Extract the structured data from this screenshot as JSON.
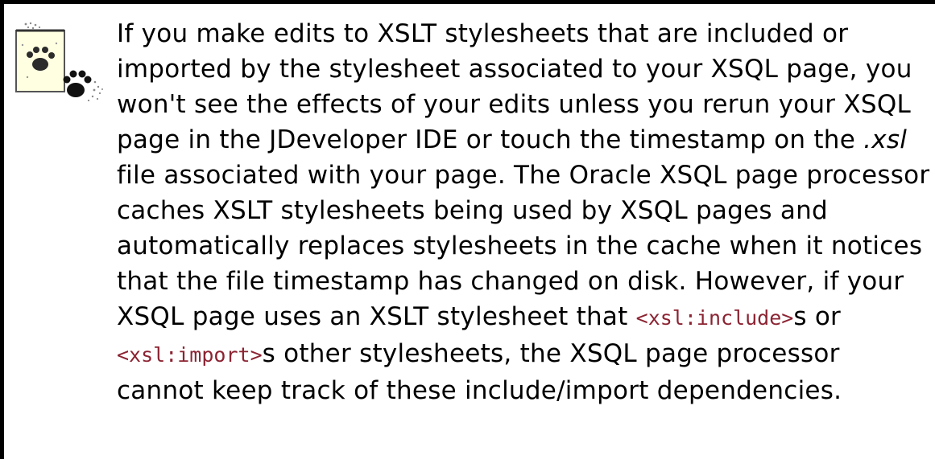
{
  "note": {
    "icon": "notepad-with-paw-icon",
    "colors": {
      "text": "#000000",
      "code": "#8b2332",
      "border": "#000000",
      "icon_paper": "#ffffe1"
    },
    "segments": {
      "s1": "If you make edits to XSLT stylesheets that are included or imported by the stylesheet associated to your XSQL page, you won't see the effects of your edits unless you rerun your XSQL page in the JDeveloper IDE or touch the timestamp on the ",
      "s2_file": ".xsl",
      "s3": " file associated with your page. The Oracle XSQL page processor caches XSLT stylesheets being used by XSQL pages and automatically replaces stylesheets in the cache when it notices that the file timestamp has changed on disk. However, if your",
      "s4": "XSQL page uses an XSLT stylesheet that ",
      "s5_code": "<xsl:include>",
      "s6": "s or",
      "s7_code": "<xsl:import>",
      "s8": "s other stylesheets, the XSQL page processor",
      "s9": "cannot keep track of these include/import dependencies."
    }
  }
}
